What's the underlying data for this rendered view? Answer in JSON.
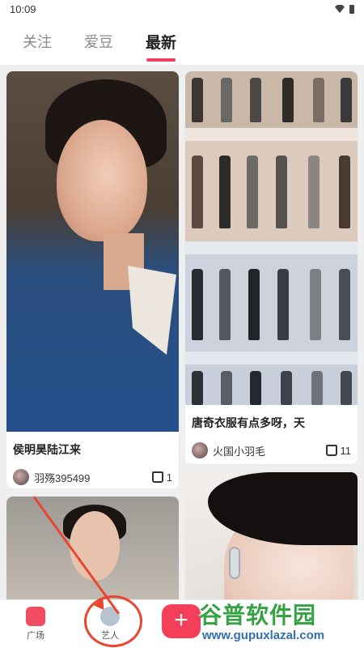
{
  "status_bar": {
    "time": "10:09"
  },
  "tabs": [
    {
      "label": "关注",
      "active": false
    },
    {
      "label": "爱豆",
      "active": false
    },
    {
      "label": "最新",
      "active": true
    }
  ],
  "feed": {
    "cards": [
      {
        "title": "侯明昊陆江来",
        "user": "羽殇395499",
        "likes": "1"
      },
      {
        "title": "唐奇衣服有点多呀，天",
        "user": "火国小羽毛",
        "likes": "11"
      }
    ]
  },
  "bottom_nav": {
    "home_label": "广场",
    "artist_label": "艺人",
    "post_symbol": "+"
  },
  "watermark": {
    "text": "谷普软件园",
    "url": "www.gupuxlazal.com"
  },
  "colors": {
    "accent": "#f23f5d",
    "annotation": "#e9452f"
  },
  "icons": [
    "wifi-icon",
    "battery-icon",
    "like-icon",
    "home-icon",
    "artist-icon",
    "plus-icon"
  ]
}
